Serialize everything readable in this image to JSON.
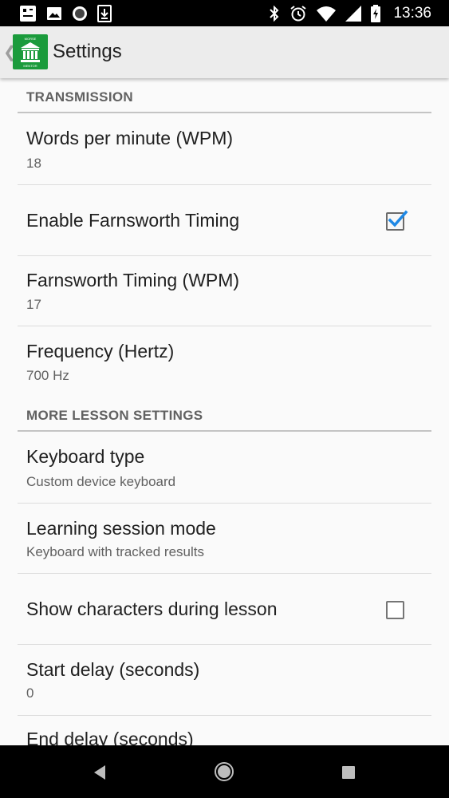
{
  "status_bar": {
    "time": "13:36",
    "left_icons": [
      "notification-app-icon",
      "image-icon",
      "circle-icon",
      "download-icon"
    ],
    "right_icons": [
      "bluetooth-icon",
      "alarm-icon",
      "wifi-icon",
      "signal-icon",
      "battery-icon"
    ]
  },
  "app_bar": {
    "title": "Settings",
    "logo_icon": "morse-mentor-logo-icon",
    "logo_text_top": "MORSE",
    "logo_text_bottom": "MENTOR"
  },
  "settings": {
    "categories": [
      {
        "title": "TRANSMISSION",
        "items": [
          {
            "title": "Words per minute (WPM)",
            "summary": "18"
          },
          {
            "title": "Enable Farnsworth Timing",
            "checked": true
          },
          {
            "title": "Farnsworth Timing (WPM)",
            "summary": "17"
          },
          {
            "title": "Frequency (Hertz)",
            "summary": "700 Hz"
          }
        ]
      },
      {
        "title": "MORE LESSON SETTINGS",
        "items": [
          {
            "title": "Keyboard type",
            "summary": "Custom device keyboard"
          },
          {
            "title": "Learning session mode",
            "summary": "Keyboard with tracked results"
          },
          {
            "title": "Show characters during lesson",
            "checked": false
          },
          {
            "title": "Start delay (seconds)",
            "summary": "0"
          },
          {
            "title": "End delay (seconds)"
          }
        ]
      }
    ]
  },
  "nav_bar": {
    "buttons": [
      "back-icon",
      "home-icon",
      "recents-icon"
    ]
  },
  "colors": {
    "app_bar_bg": "#ececec",
    "logo_green": "#1b9b3c",
    "check_blue": "#1e88e5",
    "category_text": "#616161"
  }
}
